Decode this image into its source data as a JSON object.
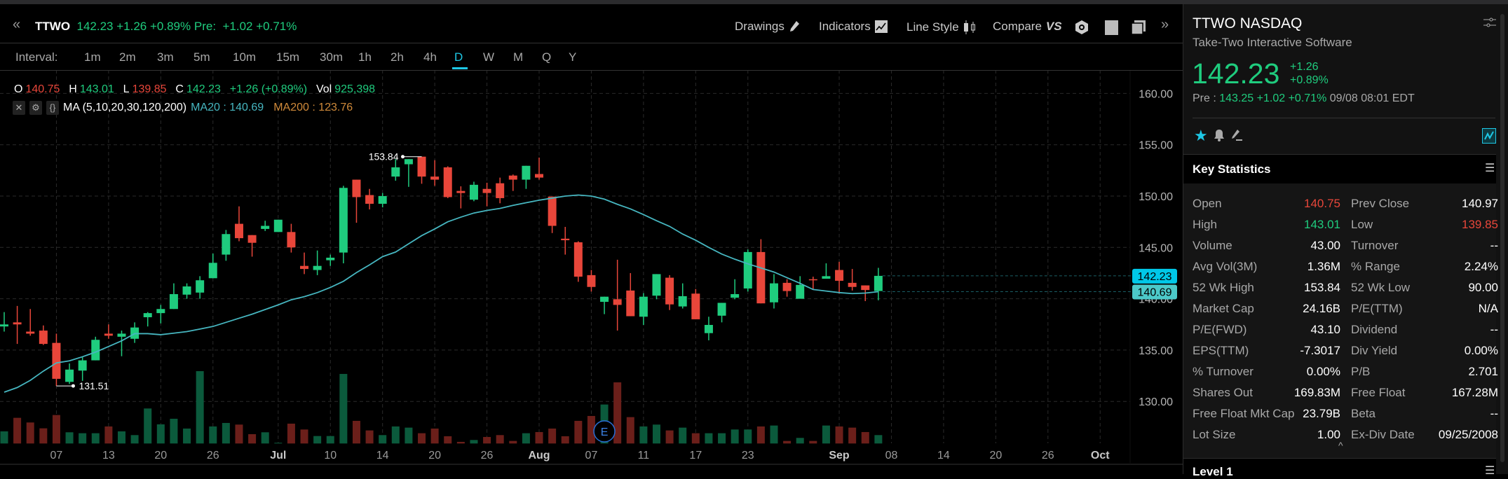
{
  "header": {
    "symbol": "TTWO",
    "price": "142.23",
    "change": "+1.26",
    "change_pct": "+0.89%",
    "pre_label": "Pre:",
    "pre_change": "+1.02",
    "pre_change_pct": "+0.71%"
  },
  "toolbar": {
    "drawings": "Drawings",
    "indicators": "Indicators",
    "line_style": "Line Style",
    "compare": "Compare",
    "compare_icon_text": "VS"
  },
  "intervals": {
    "label": "Interval:",
    "items": [
      "1m",
      "2m",
      "3m",
      "5m",
      "10m",
      "15m",
      "30m",
      "1h",
      "2h",
      "4h",
      "D",
      "W",
      "M",
      "Q",
      "Y"
    ],
    "active": "D"
  },
  "ohlc": {
    "o_label": "O",
    "o": "140.75",
    "h_label": "H",
    "h": "143.01",
    "l_label": "L",
    "l": "139.85",
    "c_label": "C",
    "c": "142.23",
    "chg": "+1.26 (+0.89%)",
    "vol_label": "Vol",
    "vol": "925,398"
  },
  "ma": {
    "label": "MA (5,10,20,30,120,200)",
    "ma20": "MA20 : 140.69",
    "ma200": "MA200 : 123.76"
  },
  "colors": {
    "up": "#1fcc7e",
    "down": "#e8463a",
    "up_vol": "#0b5a3c",
    "down_vol": "#6b1f1a",
    "ma20": "#46b6c0",
    "ma200": "#d08a3a",
    "accent": "#1ec8e6"
  },
  "chart_data": {
    "type": "candlestick",
    "ylim": [
      128,
      162
    ],
    "yticks": [
      "160.00",
      "155.00",
      "150.00",
      "145.00",
      "140.00",
      "135.00",
      "130.00"
    ],
    "ytick_values": [
      160,
      155,
      150,
      145,
      140,
      135,
      130
    ],
    "xticks": [
      {
        "i": 4,
        "label": "07",
        "bold": false
      },
      {
        "i": 8,
        "label": "13",
        "bold": false
      },
      {
        "i": 12,
        "label": "20",
        "bold": false
      },
      {
        "i": 16,
        "label": "26",
        "bold": false
      },
      {
        "i": 21,
        "label": "Jul",
        "bold": true
      },
      {
        "i": 25,
        "label": "10",
        "bold": false
      },
      {
        "i": 29,
        "label": "14",
        "bold": false
      },
      {
        "i": 33,
        "label": "20",
        "bold": false
      },
      {
        "i": 37,
        "label": "26",
        "bold": false
      },
      {
        "i": 41,
        "label": "Aug",
        "bold": true
      },
      {
        "i": 45,
        "label": "07",
        "bold": false
      },
      {
        "i": 49,
        "label": "11",
        "bold": false
      },
      {
        "i": 53,
        "label": "17",
        "bold": false
      },
      {
        "i": 57,
        "label": "23",
        "bold": false
      },
      {
        "i": 64,
        "label": "Sep",
        "bold": true
      },
      {
        "i": 68,
        "label": "08",
        "bold": false
      },
      {
        "i": 72,
        "label": "14",
        "bold": false
      },
      {
        "i": 76,
        "label": "20",
        "bold": false
      },
      {
        "i": 80,
        "label": "26",
        "bold": false
      },
      {
        "i": 84,
        "label": "Oct",
        "bold": true
      }
    ],
    "fields": [
      "open",
      "high",
      "low",
      "close",
      "rel_volume",
      "ma20"
    ],
    "candles": [
      [
        137.3,
        138.7,
        136.8,
        137.5,
        52,
        130.9
      ],
      [
        137.7,
        139.3,
        135.6,
        137.5,
        110,
        131.35
      ],
      [
        136.8,
        139.0,
        136.4,
        136.6,
        90,
        132.05
      ],
      [
        136.9,
        137.4,
        135.5,
        135.6,
        65,
        132.95
      ],
      [
        135.7,
        136.6,
        131.51,
        132.2,
        122,
        133.75
      ],
      [
        131.9,
        133.7,
        131.7,
        133.1,
        48,
        133.95
      ],
      [
        133.0,
        134.3,
        132.0,
        134.0,
        44,
        134.35
      ],
      [
        134.0,
        136.3,
        134.0,
        136.0,
        44,
        134.8
      ],
      [
        136.6,
        137.5,
        136.1,
        136.4,
        73,
        135.35
      ],
      [
        136.3,
        136.9,
        134.4,
        136.6,
        52,
        135.9
      ],
      [
        136.1,
        137.7,
        135.7,
        137.2,
        36,
        136.6
      ],
      [
        138.2,
        138.7,
        137.3,
        138.6,
        150,
        136.6
      ],
      [
        138.6,
        139.4,
        137.6,
        139.0,
        82,
        136.5
      ],
      [
        139.0,
        141.5,
        139.0,
        140.45,
        106,
        136.65
      ],
      [
        140.4,
        141.5,
        140.0,
        141.2,
        64,
        136.8
      ],
      [
        140.6,
        142.2,
        140.0,
        141.8,
        310,
        137.05
      ],
      [
        142.0,
        144.4,
        142.0,
        143.5,
        73,
        137.3
      ],
      [
        144.3,
        146.7,
        143.7,
        146.3,
        88,
        137.7
      ],
      [
        147.3,
        149.0,
        145.6,
        145.9,
        81,
        138.1
      ],
      [
        146.2,
        146.2,
        144.1,
        145.45,
        40,
        138.5
      ],
      [
        146.8,
        147.6,
        146.6,
        147.1,
        48,
        138.95
      ],
      [
        146.5,
        147.7,
        146.5,
        147.7,
        3,
        139.4
      ],
      [
        146.5,
        147.3,
        144.5,
        145.0,
        85,
        139.9
      ],
      [
        143.2,
        144.5,
        142.4,
        142.9,
        60,
        140.2
      ],
      [
        142.8,
        144.7,
        142.3,
        143.2,
        32,
        140.6
      ],
      [
        143.75,
        144.3,
        143.2,
        144.0,
        32,
        141.1
      ],
      [
        144.5,
        151.0,
        143.45,
        150.8,
        298,
        141.7
      ],
      [
        151.6,
        151.6,
        147.4,
        149.9,
        97,
        142.55
      ],
      [
        150.1,
        150.7,
        148.7,
        149.25,
        56,
        143.3
      ],
      [
        149.25,
        150.3,
        148.9,
        150.0,
        36,
        144.1
      ],
      [
        151.9,
        153.6,
        151.5,
        152.8,
        73,
        144.55
      ],
      [
        153.1,
        153.6,
        150.9,
        153.6,
        68,
        145.35
      ],
      [
        153.84,
        153.84,
        151.2,
        151.9,
        44,
        146.15
      ],
      [
        151.9,
        153.5,
        151.0,
        151.6,
        64,
        146.8
      ],
      [
        152.8,
        152.9,
        149.8,
        149.9,
        31,
        147.5
      ],
      [
        150.5,
        150.95,
        148.8,
        150.3,
        7,
        147.95
      ],
      [
        149.65,
        151.4,
        149.5,
        151.1,
        15,
        148.35
      ],
      [
        150.7,
        151.3,
        149.0,
        150.3,
        28,
        148.6
      ],
      [
        151.25,
        151.8,
        149.3,
        149.8,
        36,
        148.8
      ],
      [
        152.0,
        152.1,
        150.5,
        151.6,
        11,
        149.1
      ],
      [
        151.6,
        152.95,
        150.7,
        152.95,
        44,
        149.35
      ],
      [
        152.15,
        153.75,
        151.6,
        151.8,
        49,
        149.6
      ],
      [
        149.95,
        149.95,
        146.4,
        147.1,
        64,
        149.8
      ],
      [
        145.85,
        147.0,
        144.3,
        145.7,
        31,
        150.0
      ],
      [
        145.5,
        145.6,
        141.65,
        142.15,
        97,
        150.1
      ],
      [
        142.3,
        142.8,
        140.7,
        141.15,
        118,
        150.0
      ],
      [
        139.7,
        140.2,
        138.5,
        140.2,
        167,
        149.7
      ],
      [
        139.95,
        143.8,
        136.9,
        139.4,
        262,
        149.2
      ],
      [
        140.8,
        142.5,
        138.3,
        138.3,
        113,
        148.75
      ],
      [
        138.25,
        140.55,
        137.45,
        140.2,
        73,
        148.2
      ],
      [
        140.3,
        142.4,
        139.95,
        142.4,
        81,
        147.6
      ],
      [
        142.05,
        142.3,
        138.9,
        139.45,
        56,
        147.05
      ],
      [
        139.25,
        141.5,
        139.05,
        140.25,
        68,
        146.3
      ],
      [
        140.5,
        140.95,
        138.0,
        138.0,
        44,
        145.7
      ],
      [
        136.65,
        138.25,
        135.95,
        137.45,
        44,
        145.0
      ],
      [
        138.35,
        139.6,
        137.7,
        139.6,
        44,
        144.35
      ],
      [
        140.1,
        141.9,
        139.95,
        140.45,
        60,
        143.85
      ],
      [
        141.0,
        144.8,
        140.7,
        144.55,
        60,
        143.4
      ],
      [
        144.55,
        145.8,
        139.55,
        139.55,
        73,
        143.0
      ],
      [
        139.65,
        142.4,
        139.05,
        141.5,
        77,
        142.6
      ],
      [
        141.55,
        141.9,
        140.2,
        140.75,
        11,
        142.05
      ],
      [
        140.0,
        142.2,
        140.0,
        141.35,
        24,
        141.5
      ],
      [
        141.9,
        142.15,
        140.9,
        141.8,
        11,
        140.9
      ],
      [
        141.95,
        143.45,
        141.95,
        142.2,
        77,
        140.75
      ],
      [
        142.8,
        143.6,
        140.5,
        141.75,
        73,
        140.6
      ],
      [
        141.55,
        142.9,
        140.8,
        141.15,
        68,
        140.5
      ],
      [
        141.3,
        141.3,
        139.77,
        140.85,
        49,
        140.55
      ],
      [
        140.75,
        143.01,
        139.85,
        142.23,
        36,
        140.69
      ]
    ],
    "high_marker": {
      "i": 32,
      "label": "153.84",
      "value": 153.84
    },
    "low_marker": {
      "i": 4,
      "label": "131.51",
      "value": 131.51
    },
    "earnings_marker": {
      "i": 46,
      "label": "E"
    },
    "last_price_tag": {
      "label": "142.23",
      "value": 142.23
    },
    "ma_tag": {
      "label": "140.69",
      "value": 140.69
    }
  },
  "panel": {
    "title": "TTWO NASDAQ",
    "company": "Take-Two Interactive Software",
    "price": "142.23",
    "change": "+1.26",
    "change_pct": "+0.89%",
    "pre_label": "Pre :",
    "pre_price": "143.25",
    "pre_change": "+1.02",
    "pre_change_pct": "+0.71%",
    "pre_time": "09/08 08:01 EDT"
  },
  "key_stats": {
    "title": "Key Statistics",
    "rows": [
      {
        "l": "Open",
        "lv": "140.75",
        "lc": "#e8463a",
        "r": "Prev Close",
        "rv": "140.97",
        "rc": "#ffffff"
      },
      {
        "l": "High",
        "lv": "143.01",
        "lc": "#1fcc7e",
        "r": "Low",
        "rv": "139.85",
        "rc": "#e8463a"
      },
      {
        "l": "Volume",
        "lv": "43.00",
        "lc": "#ffffff",
        "r": "Turnover",
        "rv": "--",
        "rc": "#ffffff"
      },
      {
        "l": "Avg Vol(3M)",
        "lv": "1.36M",
        "lc": "#ffffff",
        "r": "% Range",
        "rv": "2.24%",
        "rc": "#ffffff"
      },
      {
        "l": "52 Wk High",
        "lv": "153.84",
        "lc": "#ffffff",
        "r": "52 Wk Low",
        "rv": "90.00",
        "rc": "#ffffff"
      },
      {
        "l": "Market Cap",
        "lv": "24.16B",
        "lc": "#ffffff",
        "r": "P/E(TTM)",
        "rv": "N/A",
        "rc": "#ffffff"
      },
      {
        "l": "P/E(FWD)",
        "lv": "43.10",
        "lc": "#ffffff",
        "r": "Dividend",
        "rv": "--",
        "rc": "#ffffff"
      },
      {
        "l": "EPS(TTM)",
        "lv": "-7.3017",
        "lc": "#ffffff",
        "r": "Div Yield",
        "rv": "0.00%",
        "rc": "#ffffff"
      },
      {
        "l": "% Turnover",
        "lv": "0.00%",
        "lc": "#ffffff",
        "r": "P/B",
        "rv": "2.701",
        "rc": "#ffffff"
      },
      {
        "l": "Shares Out",
        "lv": "169.83M",
        "lc": "#ffffff",
        "r": "Free Float",
        "rv": "167.28M",
        "rc": "#ffffff"
      },
      {
        "l": "Free Float Mkt Cap",
        "lv": "23.79B",
        "lc": "#ffffff",
        "r": "Beta",
        "rv": "--",
        "rc": "#ffffff"
      },
      {
        "l": "Lot Size",
        "lv": "1.00",
        "lc": "#ffffff",
        "r": "Ex-Div Date",
        "rv": "09/25/2008",
        "rc": "#ffffff"
      }
    ]
  },
  "level1": {
    "title": "Level 1"
  }
}
